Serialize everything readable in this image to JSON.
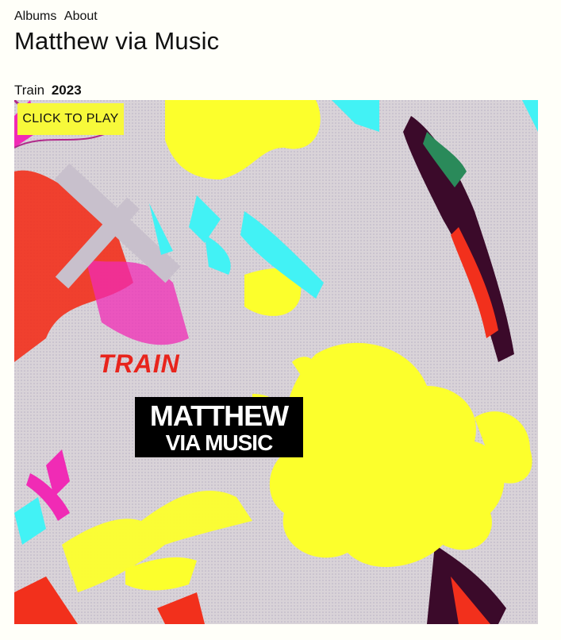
{
  "nav": {
    "items": [
      "Albums",
      "About"
    ]
  },
  "site": {
    "title": "Matthew via Music"
  },
  "album": {
    "title": "Train",
    "year": "2023",
    "play_label": "CLICK TO PLAY",
    "cover": {
      "title_art": "TRAIN",
      "logo_line1": "MATTHEW",
      "logo_line2": "VIA MUSIC"
    }
  },
  "colors": {
    "yellow": "#fcff2c",
    "cyan": "#42f2f5",
    "red": "#f2301c",
    "magenta": "#f02bb5",
    "background": "#fffff9"
  }
}
